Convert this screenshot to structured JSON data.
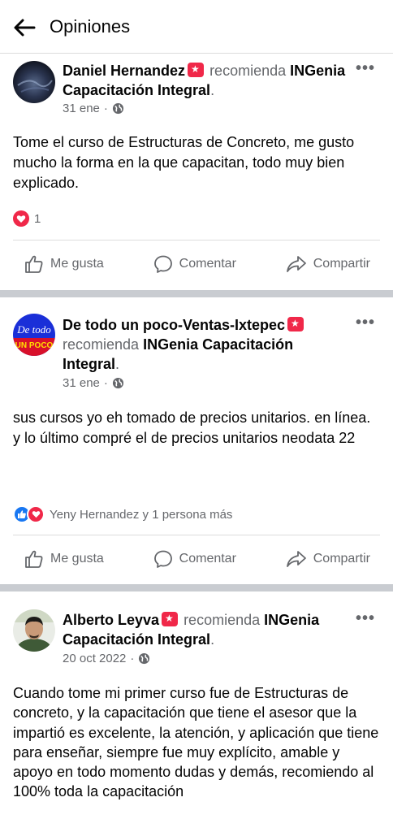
{
  "topbar": {
    "title": "Opiniones"
  },
  "actions": {
    "like": "Me gusta",
    "comment": "Comentar",
    "share": "Compartir"
  },
  "posts": [
    {
      "author": "Daniel Hernandez",
      "recommends": "recomienda",
      "page": "INGenia Capacitación Integral",
      "period": ".",
      "date": "31 ene",
      "dot": "·",
      "text": "Tome el curso de Estructuras de Concreto, me gusto mucho la forma en la que capacitan, todo muy bien explicado.",
      "reactions_text": "1"
    },
    {
      "author": "De todo un poco-Ventas-Ixtepec",
      "recommends": "recomienda",
      "page": "INGenia Capacitación Integral",
      "period": ".",
      "date": "31 ene",
      "dot": "·",
      "text_line1": "sus cursos yo eh tomado de precios unitarios. en línea.",
      "text_line2": "y lo último compré el de precios unitarios neodata 22",
      "reactions_text": "Yeny Hernandez y 1 persona más",
      "avatar_text_top": "De todo",
      "avatar_text_bottom": "UN POCO"
    },
    {
      "author": "Alberto Leyva",
      "recommends": "recomienda",
      "page": "INGenia Capacitación Integral",
      "period": ".",
      "date": "20 oct 2022",
      "dot": "·",
      "text": "Cuando tome mi primer curso fue de Estructuras de concreto, y la capacitación que tiene el asesor que la impartió es excelente, la atención, y aplicación que tiene para enseñar, siempre fue muy explícito, amable y apoyo en todo momento dudas y demás, recomiendo al 100% toda la capacitación"
    }
  ],
  "colors": {
    "heart": "#f02849",
    "like_blue": "#1877f2",
    "muted": "#65676b",
    "separator": "#c9ccd1"
  },
  "icons": {
    "back": "arrow-left-icon",
    "more": "more-dots-icon",
    "globe": "globe-icon",
    "like": "thumbs-up-icon",
    "comment": "comment-bubble-icon",
    "share": "share-arrow-icon"
  }
}
